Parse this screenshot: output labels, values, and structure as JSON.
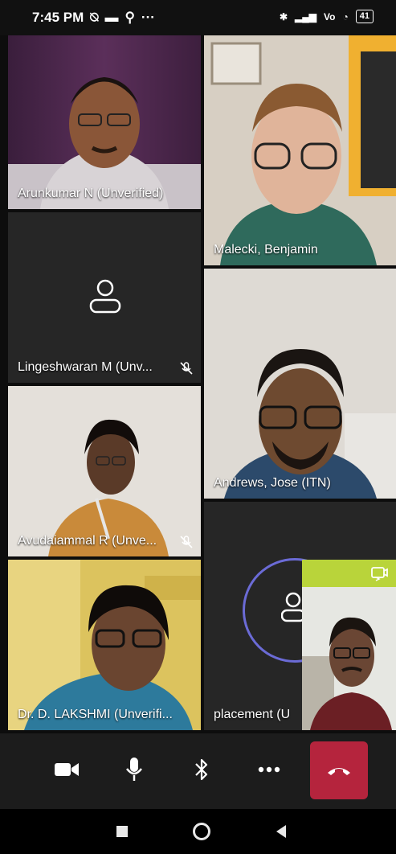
{
  "status": {
    "time": "7:45 PM",
    "more": "···",
    "battery": "41"
  },
  "participants": [
    {
      "name": "Arunkumar N (Unverified)"
    },
    {
      "name": "Malecki, Benjamin"
    },
    {
      "name": "Lingeshwaran M (Unv..."
    },
    {
      "name": "Andrews, Jose (ITN)"
    },
    {
      "name": "Avudaiammal R (Unve..."
    },
    {
      "name": "Dr. D. LAKSHMI (Unverifi..."
    },
    {
      "name": "placement (U"
    }
  ],
  "controls": {
    "camera": "camera-icon",
    "mic": "microphone-icon",
    "bluetooth": "bluetooth-icon",
    "more": "more-icon",
    "hangup": "hang-up-icon"
  },
  "colors": {
    "hangup": "#b5243d",
    "active_ring": "#6b6bd6",
    "tile": "#2b2b2b"
  }
}
